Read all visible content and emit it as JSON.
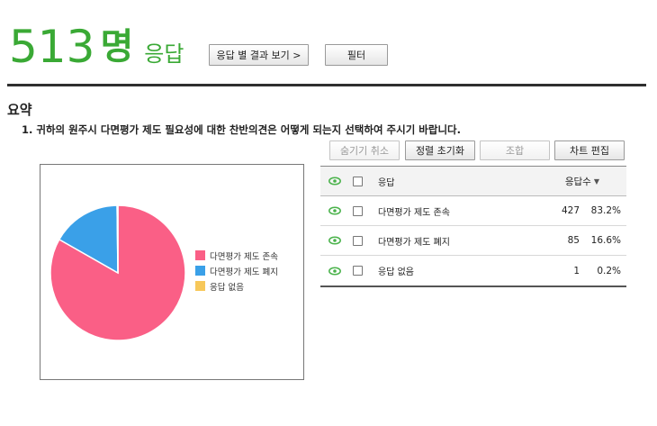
{
  "header": {
    "count": "513",
    "unit": "명",
    "response_word": "응답",
    "results_button": "응답 별 결과 보기 >",
    "filter_button": "필터"
  },
  "summary": {
    "title": "요약",
    "question": "1. 귀하의 원주시 다면평가 제도 필요성에 대한 찬반의견은 어떻게 되는지 선택하여 주시기 바랍니다."
  },
  "toolbar": {
    "hide_cancel": "숨기기 취소",
    "sort_reset": "정렬 초기화",
    "combine": "조합",
    "chart_edit": "차트 편집"
  },
  "table": {
    "header_answer": "응답",
    "header_count": "응답수",
    "rows": [
      {
        "answer": "다면평가 제도 존속",
        "count": "427",
        "pct": "83.2%"
      },
      {
        "answer": "다면평가 제도 폐지",
        "count": "85",
        "pct": "16.6%"
      },
      {
        "answer": "응답 없음",
        "count": "1",
        "pct": "0.2%"
      }
    ]
  },
  "chart_data": {
    "type": "pie",
    "categories": [
      "다면평가 제도 존속",
      "다면평가 제도 폐지",
      "응답 없음"
    ],
    "values": [
      427,
      85,
      1
    ],
    "colors": [
      "#fa5f86",
      "#3aa0e8",
      "#f7c85a"
    ],
    "legend": "right"
  },
  "colors": {
    "accent_green": "#3aa935",
    "eye_green": "#49b24a"
  }
}
